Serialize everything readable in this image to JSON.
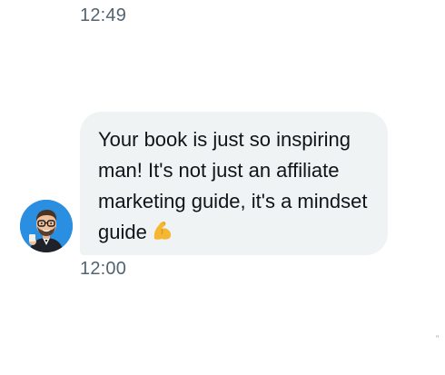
{
  "conversation": {
    "earlier_timestamp": "12:49",
    "message": {
      "text": "Your book is just so inspiring man! It's not just an affiliate marketing guide, it's a mindset guide",
      "emoji_icon": "flexed-biceps-icon",
      "timestamp": "12:00"
    },
    "avatar_icon": "user-avatar-icon",
    "corner_mark": "\""
  },
  "colors": {
    "bubble_bg": "#eff3f4",
    "timestamp": "#536471",
    "text": "#0f1419",
    "avatar_bg": "#2a8fe0"
  }
}
